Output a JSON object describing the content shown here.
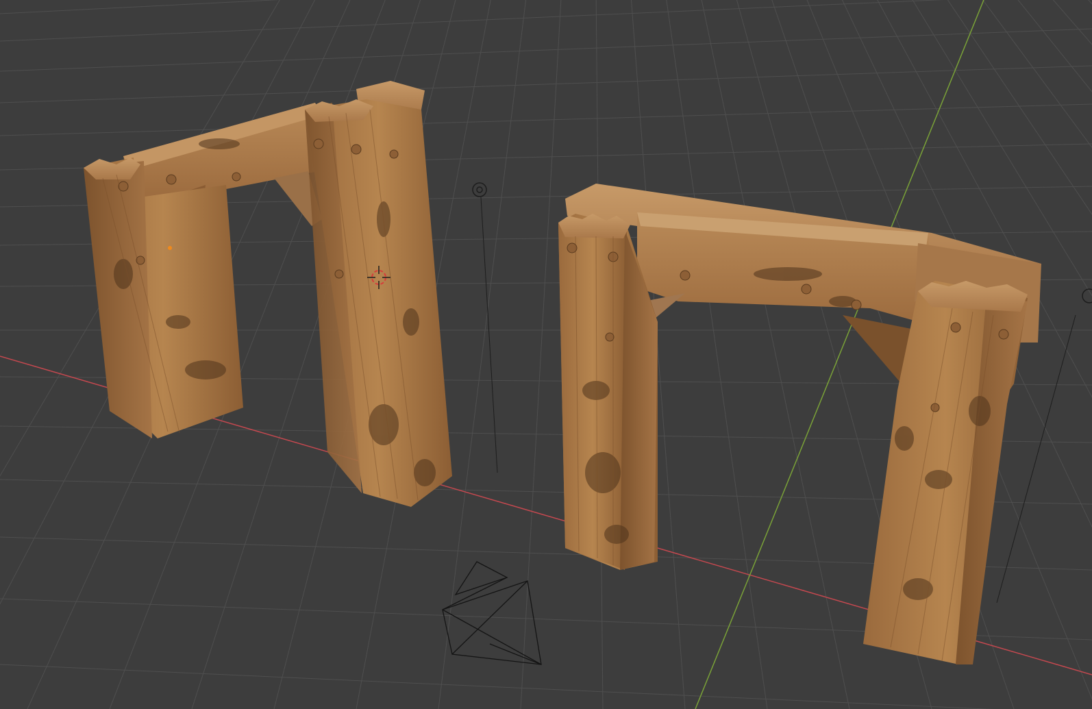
{
  "viewport": {
    "name": "3D Viewport",
    "background_color": "#3d3d3d",
    "grid_color": "#4f4f4f",
    "x_axis_color": "#c4484f",
    "y_axis_color": "#7aa238",
    "wood_light_color": "#b68451",
    "wood_mid_color": "#9c6b3e",
    "wood_dark_color": "#6e4826",
    "camera_wire_color": "#1a1a1a",
    "cursor_color": "#d83a3a"
  },
  "objects": [
    {
      "name": "wooden-arch-left",
      "kind": "mesh"
    },
    {
      "name": "wooden-arch-right",
      "kind": "mesh"
    },
    {
      "name": "scene-camera",
      "kind": "camera",
      "icon": "camera-wireframe-icon"
    },
    {
      "name": "scene-light",
      "kind": "light",
      "icon": "light-icon"
    },
    {
      "name": "3d-cursor",
      "kind": "cursor",
      "icon": "3d-cursor-icon"
    }
  ]
}
